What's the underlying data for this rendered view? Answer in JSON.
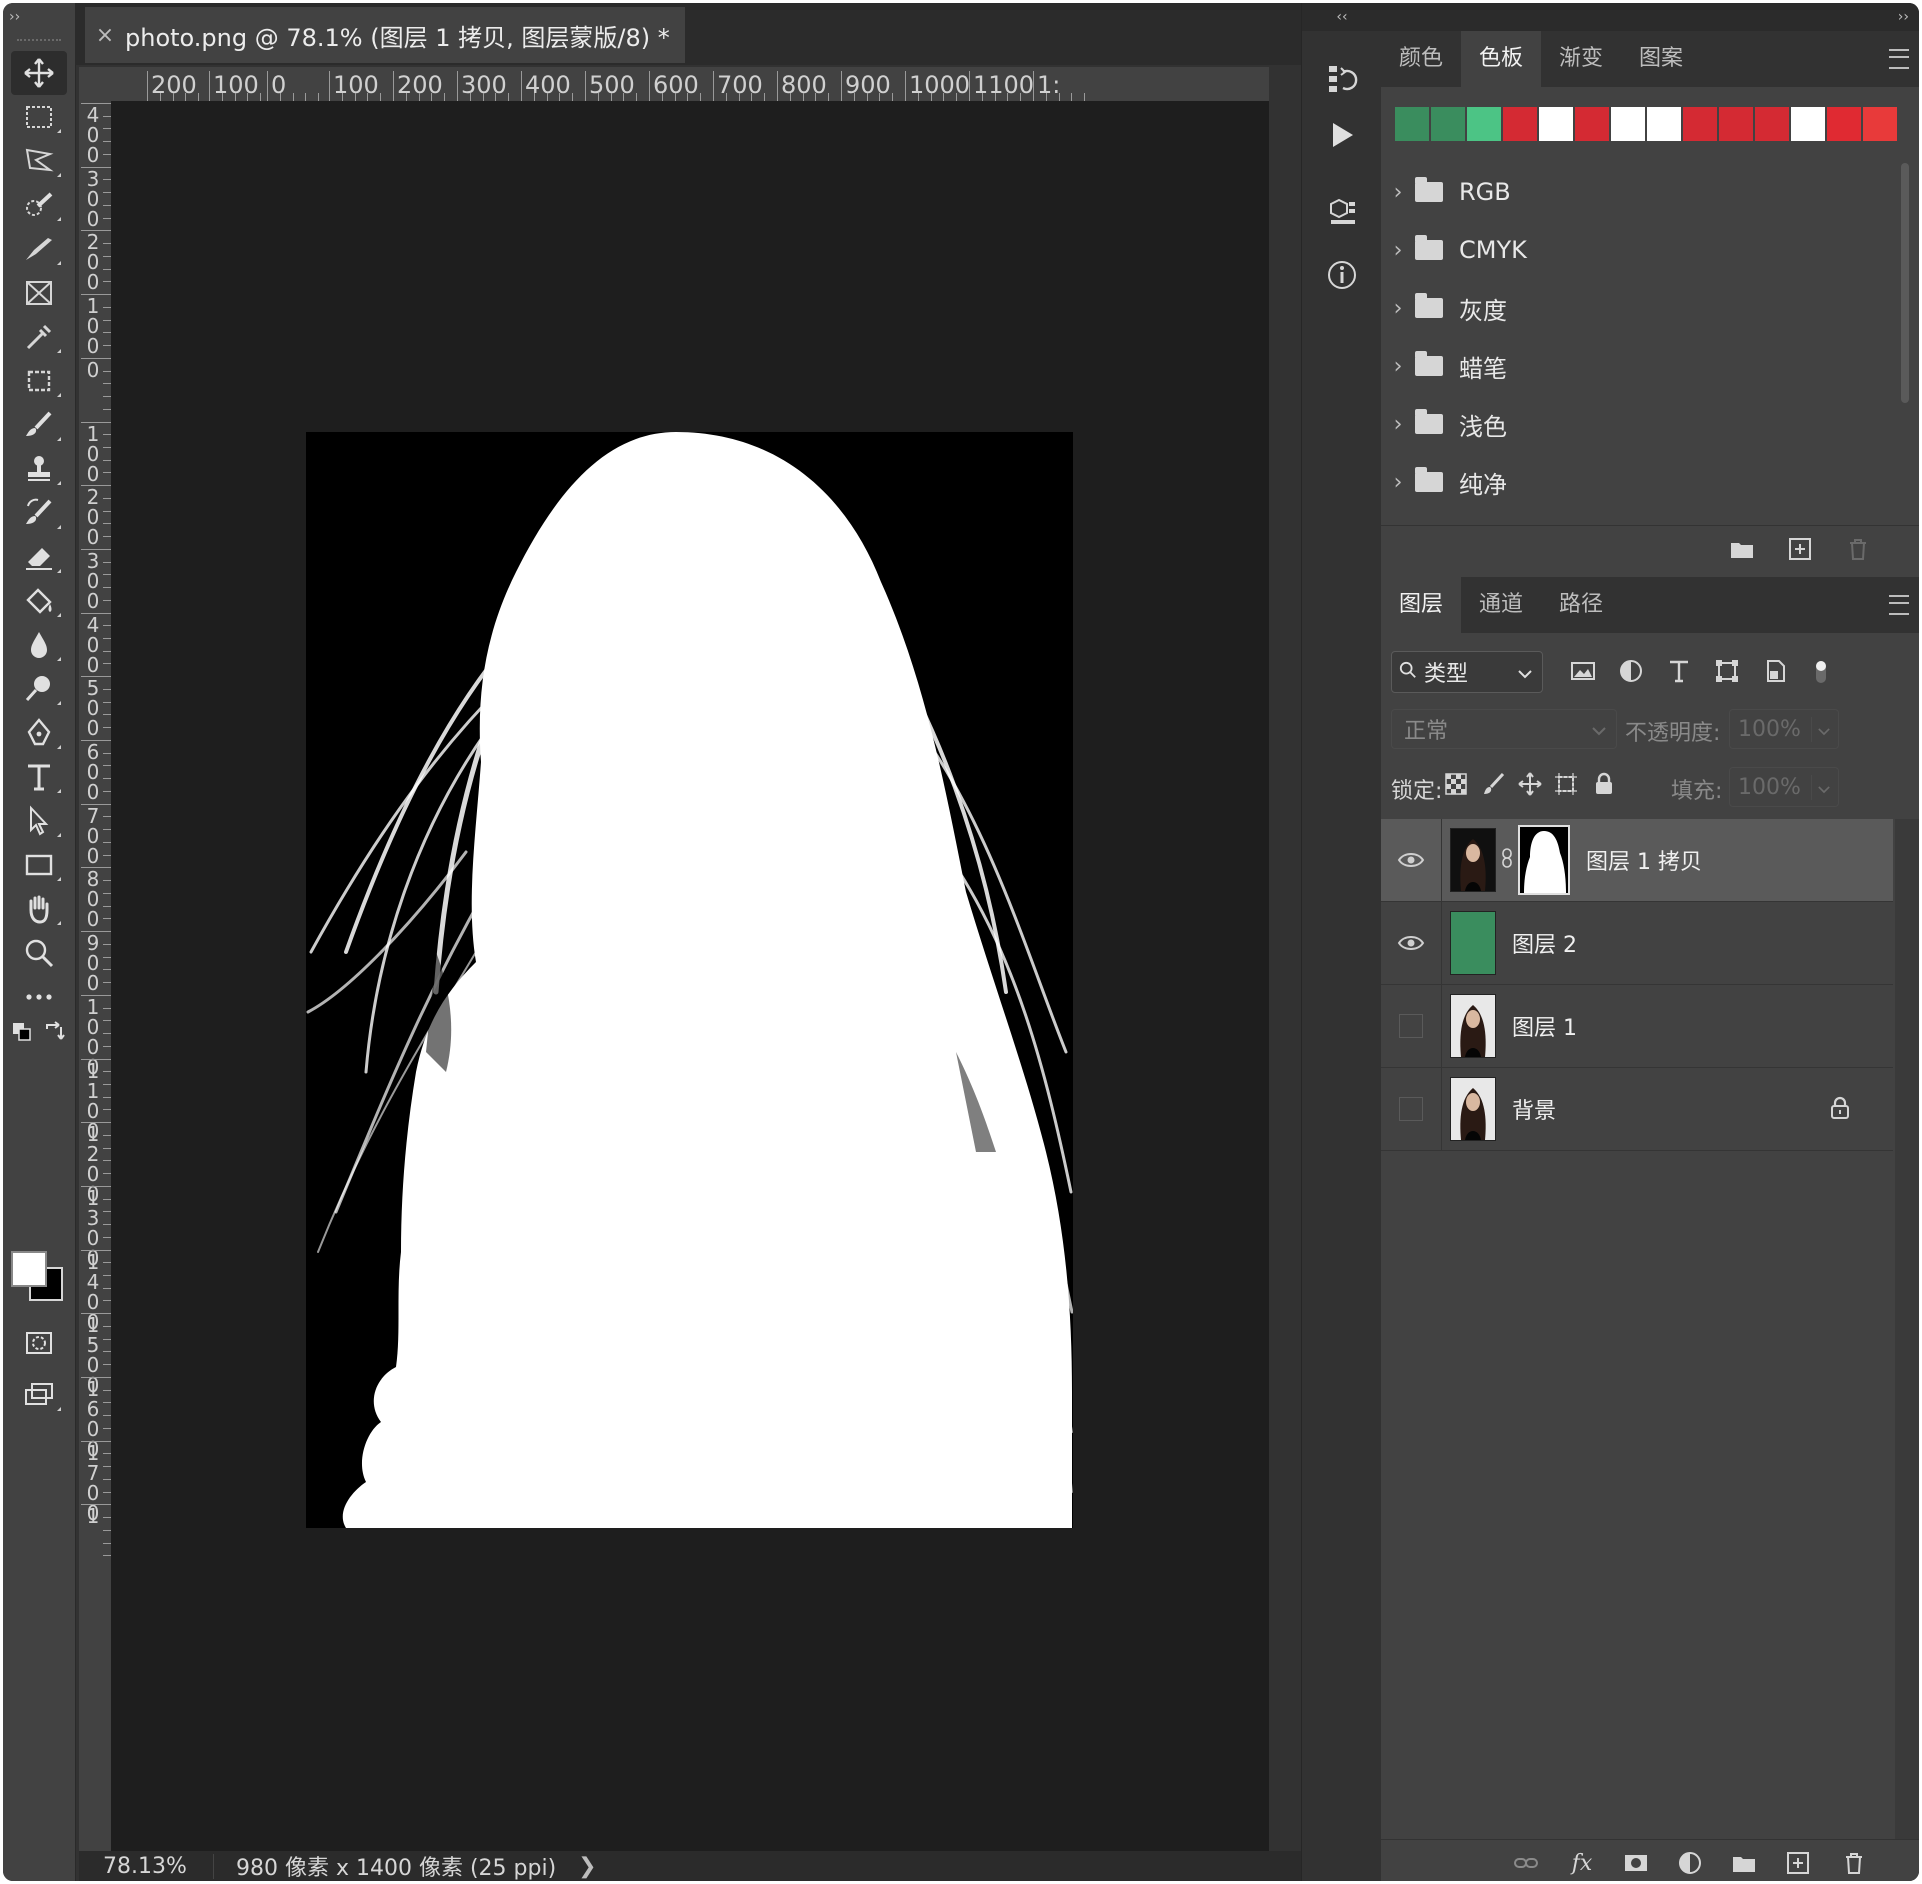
{
  "document": {
    "tab_title": "photo.png @ 78.1% (图层 1 拷贝, 图层蒙版/8) *",
    "close_glyph": "×"
  },
  "toolbar": {
    "collapse_glyph": "››",
    "tools": [
      "move-tool",
      "rectangular-marquee-tool",
      "polygonal-lasso-tool",
      "quick-selection-tool",
      "healing-brush-tool",
      "frame-tool",
      "eyedropper-tool",
      "crop-tool",
      "brush-tool",
      "clone-stamp-tool",
      "history-brush-tool",
      "eraser-tool",
      "paint-bucket-tool",
      "blur-tool",
      "dodge-tool",
      "pen-tool",
      "type-tool",
      "path-selection-tool",
      "rectangle-tool",
      "hand-tool",
      "zoom-tool",
      "edit-toolbar"
    ]
  },
  "rulers": {
    "top_labels": [
      "200",
      "100",
      "0",
      "100",
      "200",
      "300",
      "400",
      "500",
      "600",
      "700",
      "800",
      "900",
      "1000",
      "1100",
      "1:"
    ],
    "left_labels": [
      "400",
      "300",
      "200",
      "100",
      "0",
      "100",
      "200",
      "300",
      "400",
      "500",
      "600",
      "700",
      "800",
      "900",
      "1000",
      "1100",
      "1200",
      "1300",
      "1400",
      "1500",
      "1600",
      "1700",
      "1"
    ]
  },
  "status_bar": {
    "zoom": "78.13%",
    "doc_info": "980 像素 x 1400 像素 (25 ppi)",
    "arrow": "❯"
  },
  "dock_mid": {
    "collapse_glyph": "‹‹",
    "icons": [
      "history-icon",
      "actions-play-icon",
      "3d-icon",
      "info-icon"
    ]
  },
  "swatches_panel": {
    "collapse_glyph": "››",
    "tabs": [
      "颜色",
      "色板",
      "渐变",
      "图案"
    ],
    "active_tab": "色板",
    "recent_colors": [
      "#3a8d5e",
      "#3a8d5e",
      "#4cc485",
      "#d42a33",
      "#ffffff",
      "#d42a33",
      "#ffffff",
      "#ffffff",
      "#d42a33",
      "#d42a33",
      "#d42a33",
      "#ffffff",
      "#e02a32",
      "#e83a3a"
    ],
    "groups": [
      "RGB",
      "CMYK",
      "灰度",
      "蜡笔",
      "浅色",
      "纯净"
    ]
  },
  "layers_panel": {
    "tabs": [
      "图层",
      "通道",
      "路径"
    ],
    "active_tab": "图层",
    "filter_label": "类型",
    "blend_mode": "正常",
    "opacity_label": "不透明度:",
    "opacity_value": "100%",
    "lock_label": "锁定:",
    "fill_label": "填充:",
    "fill_value": "100%",
    "layers": [
      {
        "name": "图层 1 拷贝",
        "visible": true,
        "selected": true,
        "has_mask": true
      },
      {
        "name": "图层 2",
        "visible": true,
        "selected": false,
        "color": "#3a8d5e"
      },
      {
        "name": "图层 1",
        "visible": false,
        "selected": false
      },
      {
        "name": "背景",
        "visible": false,
        "selected": false,
        "locked": true
      }
    ]
  }
}
